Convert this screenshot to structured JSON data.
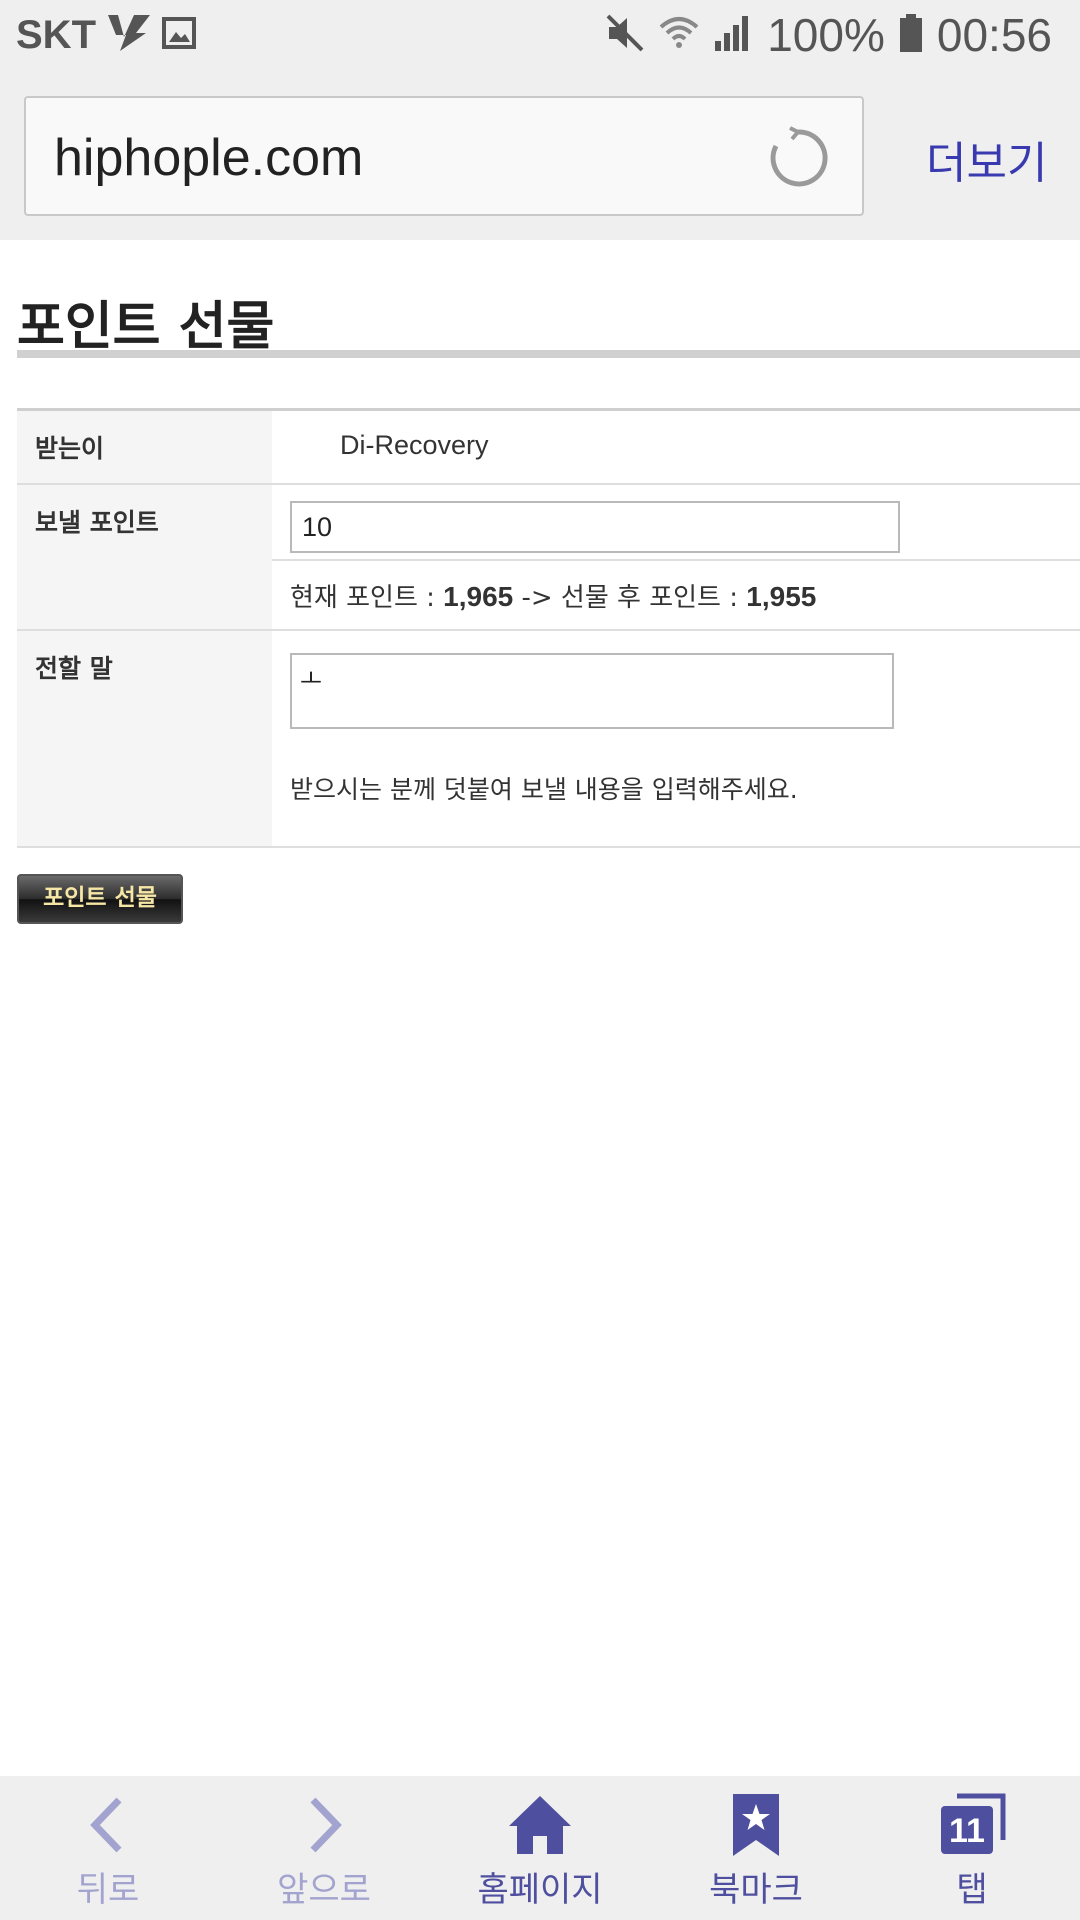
{
  "status_bar": {
    "carrier": "SKT",
    "battery": "100%",
    "time": "00:56"
  },
  "browser": {
    "url": "hiphople.com",
    "more_label": "더보기"
  },
  "page": {
    "title": "포인트 선물",
    "recipient_label": "받는이",
    "recipient_value": "Di-Recovery",
    "points_label": "보낼 포인트",
    "points_value": "10",
    "current_points_text": "현재 포인트 : ",
    "current_points_value": "1,965",
    "arrow_text": " -> 선물 후 포인트 : ",
    "after_points_value": "1,955",
    "message_label": "전할 말",
    "message_value": "ㅗ",
    "message_help": "받으시는 분께 덧붙여 보낼 내용을 입력해주세요.",
    "submit_label": "포인트 선물"
  },
  "bottom_nav": {
    "back": "뒤로",
    "forward": "앞으로",
    "home": "홈페이지",
    "bookmark": "북마크",
    "tabs": "탭",
    "tab_count": "11"
  },
  "colors": {
    "accent": "#4f4f9f",
    "disabled": "#a3a3cf",
    "url_more": "#3a3ab0"
  }
}
